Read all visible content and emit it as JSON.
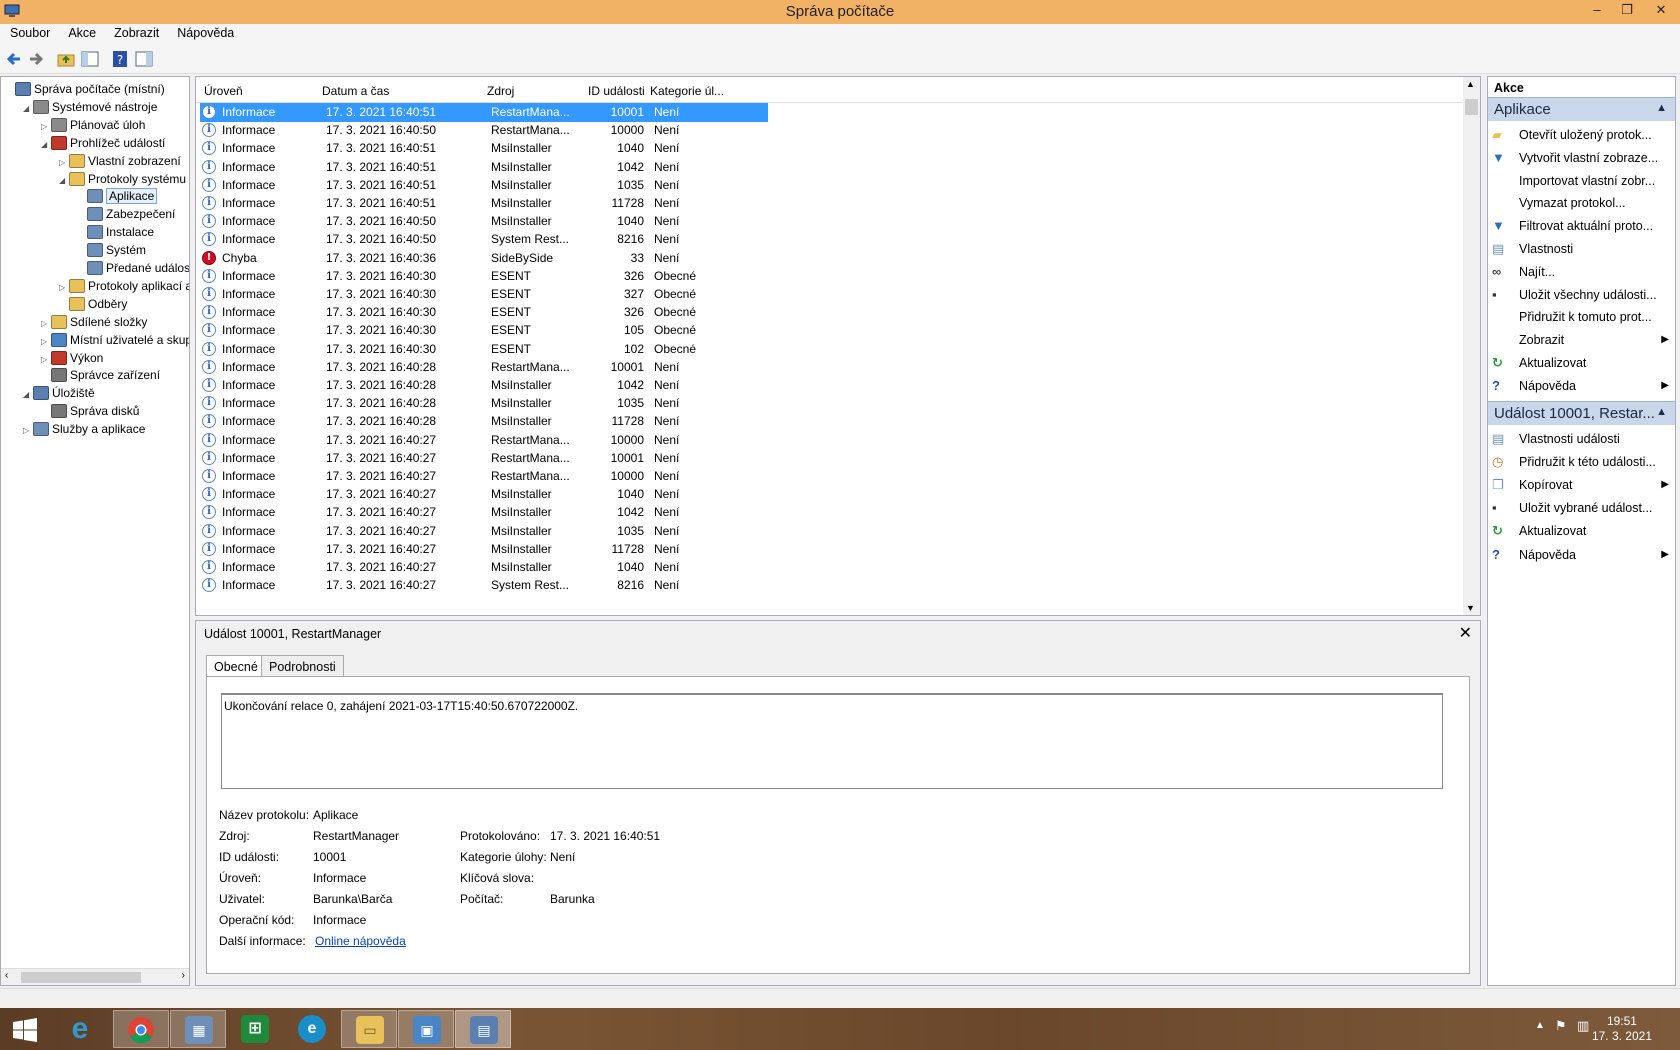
{
  "window": {
    "title": "Správa počítače"
  },
  "menu": [
    "Soubor",
    "Akce",
    "Zobrazit",
    "Nápověda"
  ],
  "tree": [
    {
      "label": "Správa počítače (místní)",
      "level": 0,
      "exp": "",
      "icon": "computer-management-icon"
    },
    {
      "label": "Systémové nástroje",
      "level": 1,
      "exp": "◢",
      "icon": "tools-icon"
    },
    {
      "label": "Plánovač úloh",
      "level": 2,
      "exp": "▷",
      "icon": "clock-icon"
    },
    {
      "label": "Prohlížeč událostí",
      "level": 2,
      "exp": "◢",
      "icon": "event-viewer-icon"
    },
    {
      "label": "Vlastní zobrazení",
      "level": 3,
      "exp": "▷",
      "icon": "folder-icon"
    },
    {
      "label": "Protokoly systému W",
      "level": 3,
      "exp": "◢",
      "icon": "folder-icon"
    },
    {
      "label": "Aplikace",
      "level": 4,
      "exp": "",
      "icon": "log-icon",
      "selected": true
    },
    {
      "label": "Zabezpečení",
      "level": 4,
      "exp": "",
      "icon": "log-icon"
    },
    {
      "label": "Instalace",
      "level": 4,
      "exp": "",
      "icon": "log-icon"
    },
    {
      "label": "Systém",
      "level": 4,
      "exp": "",
      "icon": "log-icon"
    },
    {
      "label": "Předané událostí",
      "level": 4,
      "exp": "",
      "icon": "log-icon"
    },
    {
      "label": "Protokoly aplikací a",
      "level": 3,
      "exp": "▷",
      "icon": "folder-icon"
    },
    {
      "label": "Odběry",
      "level": 3,
      "exp": "",
      "icon": "subscriptions-icon"
    },
    {
      "label": "Sdílené složky",
      "level": 2,
      "exp": "▷",
      "icon": "shared-folder-icon"
    },
    {
      "label": "Místní uživatelé a skupir",
      "level": 2,
      "exp": "▷",
      "icon": "users-icon"
    },
    {
      "label": "Výkon",
      "level": 2,
      "exp": "▷",
      "icon": "performance-icon"
    },
    {
      "label": "Správce zařízení",
      "level": 2,
      "exp": "",
      "icon": "device-manager-icon"
    },
    {
      "label": "Úložiště",
      "level": 1,
      "exp": "◢",
      "icon": "storage-icon"
    },
    {
      "label": "Správa disků",
      "level": 2,
      "exp": "",
      "icon": "disk-icon"
    },
    {
      "label": "Služby a aplikace",
      "level": 1,
      "exp": "▷",
      "icon": "services-icon"
    }
  ],
  "list": {
    "headers": [
      "Úroveň",
      "Datum a čas",
      "Zdroj",
      "ID události",
      "Kategorie úl..."
    ],
    "rows": [
      [
        "Informace",
        "17. 3. 2021 16:40:51",
        "RestartMana...",
        "10001",
        "Není"
      ],
      [
        "Informace",
        "17. 3. 2021 16:40:50",
        "RestartMana...",
        "10000",
        "Není"
      ],
      [
        "Informace",
        "17. 3. 2021 16:40:51",
        "MsiInstaller",
        "1040",
        "Není"
      ],
      [
        "Informace",
        "17. 3. 2021 16:40:51",
        "MsiInstaller",
        "1042",
        "Není"
      ],
      [
        "Informace",
        "17. 3. 2021 16:40:51",
        "MsiInstaller",
        "1035",
        "Není"
      ],
      [
        "Informace",
        "17. 3. 2021 16:40:51",
        "MsiInstaller",
        "11728",
        "Není"
      ],
      [
        "Informace",
        "17. 3. 2021 16:40:50",
        "MsiInstaller",
        "1040",
        "Není"
      ],
      [
        "Informace",
        "17. 3. 2021 16:40:50",
        "System Rest...",
        "8216",
        "Není"
      ],
      [
        "Chyba",
        "17. 3. 2021 16:40:36",
        "SideBySide",
        "33",
        "Není"
      ],
      [
        "Informace",
        "17. 3. 2021 16:40:30",
        "ESENT",
        "326",
        "Obecné"
      ],
      [
        "Informace",
        "17. 3. 2021 16:40:30",
        "ESENT",
        "327",
        "Obecné"
      ],
      [
        "Informace",
        "17. 3. 2021 16:40:30",
        "ESENT",
        "326",
        "Obecné"
      ],
      [
        "Informace",
        "17. 3. 2021 16:40:30",
        "ESENT",
        "105",
        "Obecné"
      ],
      [
        "Informace",
        "17. 3. 2021 16:40:30",
        "ESENT",
        "102",
        "Obecné"
      ],
      [
        "Informace",
        "17. 3. 2021 16:40:28",
        "RestartMana...",
        "10001",
        "Není"
      ],
      [
        "Informace",
        "17. 3. 2021 16:40:28",
        "MsiInstaller",
        "1042",
        "Není"
      ],
      [
        "Informace",
        "17. 3. 2021 16:40:28",
        "MsiInstaller",
        "1035",
        "Není"
      ],
      [
        "Informace",
        "17. 3. 2021 16:40:28",
        "MsiInstaller",
        "11728",
        "Není"
      ],
      [
        "Informace",
        "17. 3. 2021 16:40:27",
        "RestartMana...",
        "10000",
        "Není"
      ],
      [
        "Informace",
        "17. 3. 2021 16:40:27",
        "RestartMana...",
        "10001",
        "Není"
      ],
      [
        "Informace",
        "17. 3. 2021 16:40:27",
        "RestartMana...",
        "10000",
        "Není"
      ],
      [
        "Informace",
        "17. 3. 2021 16:40:27",
        "MsiInstaller",
        "1040",
        "Není"
      ],
      [
        "Informace",
        "17. 3. 2021 16:40:27",
        "MsiInstaller",
        "1042",
        "Není"
      ],
      [
        "Informace",
        "17. 3. 2021 16:40:27",
        "MsiInstaller",
        "1035",
        "Není"
      ],
      [
        "Informace",
        "17. 3. 2021 16:40:27",
        "MsiInstaller",
        "11728",
        "Není"
      ],
      [
        "Informace",
        "17. 3. 2021 16:40:27",
        "MsiInstaller",
        "1040",
        "Není"
      ],
      [
        "Informace",
        "17. 3. 2021 16:40:27",
        "System Rest...",
        "8216",
        "Není"
      ]
    ]
  },
  "detail": {
    "title": "Událost 10001, RestartManager",
    "tabs": [
      "Obecné",
      "Podrobnosti"
    ],
    "description": "Ukončování relace 0, zahájení 2021-03-17T15:40:50.670722000Z.",
    "fields": {
      "log_name_label": "Název protokolu:",
      "log_name": "Aplikace",
      "source_label": "Zdroj:",
      "source": "RestartManager",
      "logged_label": "Protokolováno:",
      "logged": "17. 3. 2021 16:40:51",
      "event_id_label": "ID události:",
      "event_id": "10001",
      "task_cat_label": "Kategorie úlohy:",
      "task_cat": "Není",
      "level_label": "Úroveň:",
      "level": "Informace",
      "keywords_label": "Klíčová slova:",
      "keywords": "",
      "user_label": "Uživatel:",
      "user": "Barunka\\Barča",
      "computer_label": "Počítač:",
      "computer": "Barunka",
      "opcode_label": "Operační kód:",
      "opcode": "Informace",
      "more_label": "Další informace:",
      "more_link": "Online nápověda"
    }
  },
  "actions": {
    "pane_title": "Akce",
    "sections": [
      {
        "title": "Aplikace",
        "items": [
          {
            "label": "Otevřít uložený protok...",
            "icon": "folder-open-icon"
          },
          {
            "label": "Vytvořit vlastní zobraze...",
            "icon": "filter-icon"
          },
          {
            "label": "Importovat vlastní zobr...",
            "icon": ""
          },
          {
            "label": "Vymazat protokol...",
            "icon": ""
          },
          {
            "label": "Filtrovat aktuální proto...",
            "icon": "filter-icon"
          },
          {
            "label": "Vlastnosti",
            "icon": "properties-icon"
          },
          {
            "label": "Najít...",
            "icon": "binoculars-icon"
          },
          {
            "label": "Uložit všechny události...",
            "icon": "save-icon"
          },
          {
            "label": "Přidružit k tomuto prot...",
            "icon": ""
          },
          {
            "label": "Zobrazit",
            "icon": "",
            "submenu": true
          },
          {
            "label": "Aktualizovat",
            "icon": "refresh-icon"
          },
          {
            "label": "Nápověda",
            "icon": "help-icon",
            "submenu": true
          }
        ]
      },
      {
        "title": "Událost 10001, Restar...",
        "items": [
          {
            "label": "Vlastnosti události",
            "icon": "properties-icon"
          },
          {
            "label": "Přidružit k této události...",
            "icon": "task-icon"
          },
          {
            "label": "Kopírovat",
            "icon": "copy-icon",
            "submenu": true
          },
          {
            "label": "Uložit vybrané událost...",
            "icon": "save-icon"
          },
          {
            "label": "Aktualizovat",
            "icon": "refresh-icon"
          },
          {
            "label": "Nápověda",
            "icon": "help-icon",
            "submenu": true
          }
        ]
      }
    ]
  },
  "taskbar": {
    "apps": [
      "start-icon",
      "internet-explorer-icon",
      "chrome-icon",
      "control-panel-icon",
      "store-icon",
      "edge-icon",
      "file-explorer-icon",
      "photos-icon",
      "computer-management-icon"
    ],
    "time": "19:51",
    "date": "17. 3. 2021"
  },
  "colors": {
    "titlebar": "#f2b265",
    "selection": "#3399ff",
    "action_header": "#c8d7ea",
    "error": "#c8102e"
  }
}
